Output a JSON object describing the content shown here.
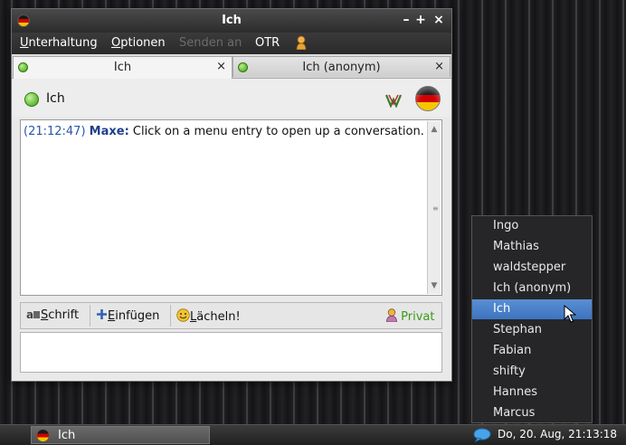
{
  "window": {
    "title": "Ich",
    "controls": {
      "minimize": "–",
      "maximize": "+",
      "close": "×"
    }
  },
  "menubar": {
    "items": [
      {
        "label": "Unterhaltung",
        "underline": "U",
        "rest": "nterhaltung",
        "enabled": true
      },
      {
        "label": "Optionen",
        "underline": "O",
        "rest": "ptionen",
        "enabled": true
      },
      {
        "label": "Senden an",
        "enabled": false
      },
      {
        "label": "OTR",
        "enabled": true
      }
    ],
    "buddy_icon": "user-icon"
  },
  "tabs": [
    {
      "label": "Ich",
      "active": true,
      "close": "×"
    },
    {
      "label": "Ich (anonym)",
      "active": false,
      "close": "×"
    }
  ],
  "contact": {
    "name": "Ich",
    "status_color": "#3f9c16"
  },
  "chat": {
    "messages": [
      {
        "time": "(21:12:47)",
        "nick": "Maxe:",
        "text": " Click on a menu entry to open up a conversation."
      }
    ]
  },
  "toolbar": {
    "font": {
      "underline": "S",
      "rest": "chrift",
      "icon": "font-icon"
    },
    "insert": {
      "underline": "E",
      "rest": "infügen",
      "icon": "plus-icon"
    },
    "smile": {
      "underline": "L",
      "rest": "ächeln!",
      "icon": "smiley-icon"
    },
    "privat": "Privat"
  },
  "popup": {
    "items": [
      "Ingo",
      "Mathias",
      "waldstepper",
      "Ich (anonym)",
      "Ich",
      "Stephan",
      "Fabian",
      "shifty",
      "Hannes",
      "Marcus"
    ],
    "selected": "Ich"
  },
  "taskbar": {
    "task_label": "Ich",
    "clock": "Do, 20. Aug, 21:13:18"
  },
  "colors": {
    "accent": "#3d74bf",
    "nick": "#1f3f8c",
    "timestamp": "#2b55a6",
    "privat": "#3b9a18"
  }
}
